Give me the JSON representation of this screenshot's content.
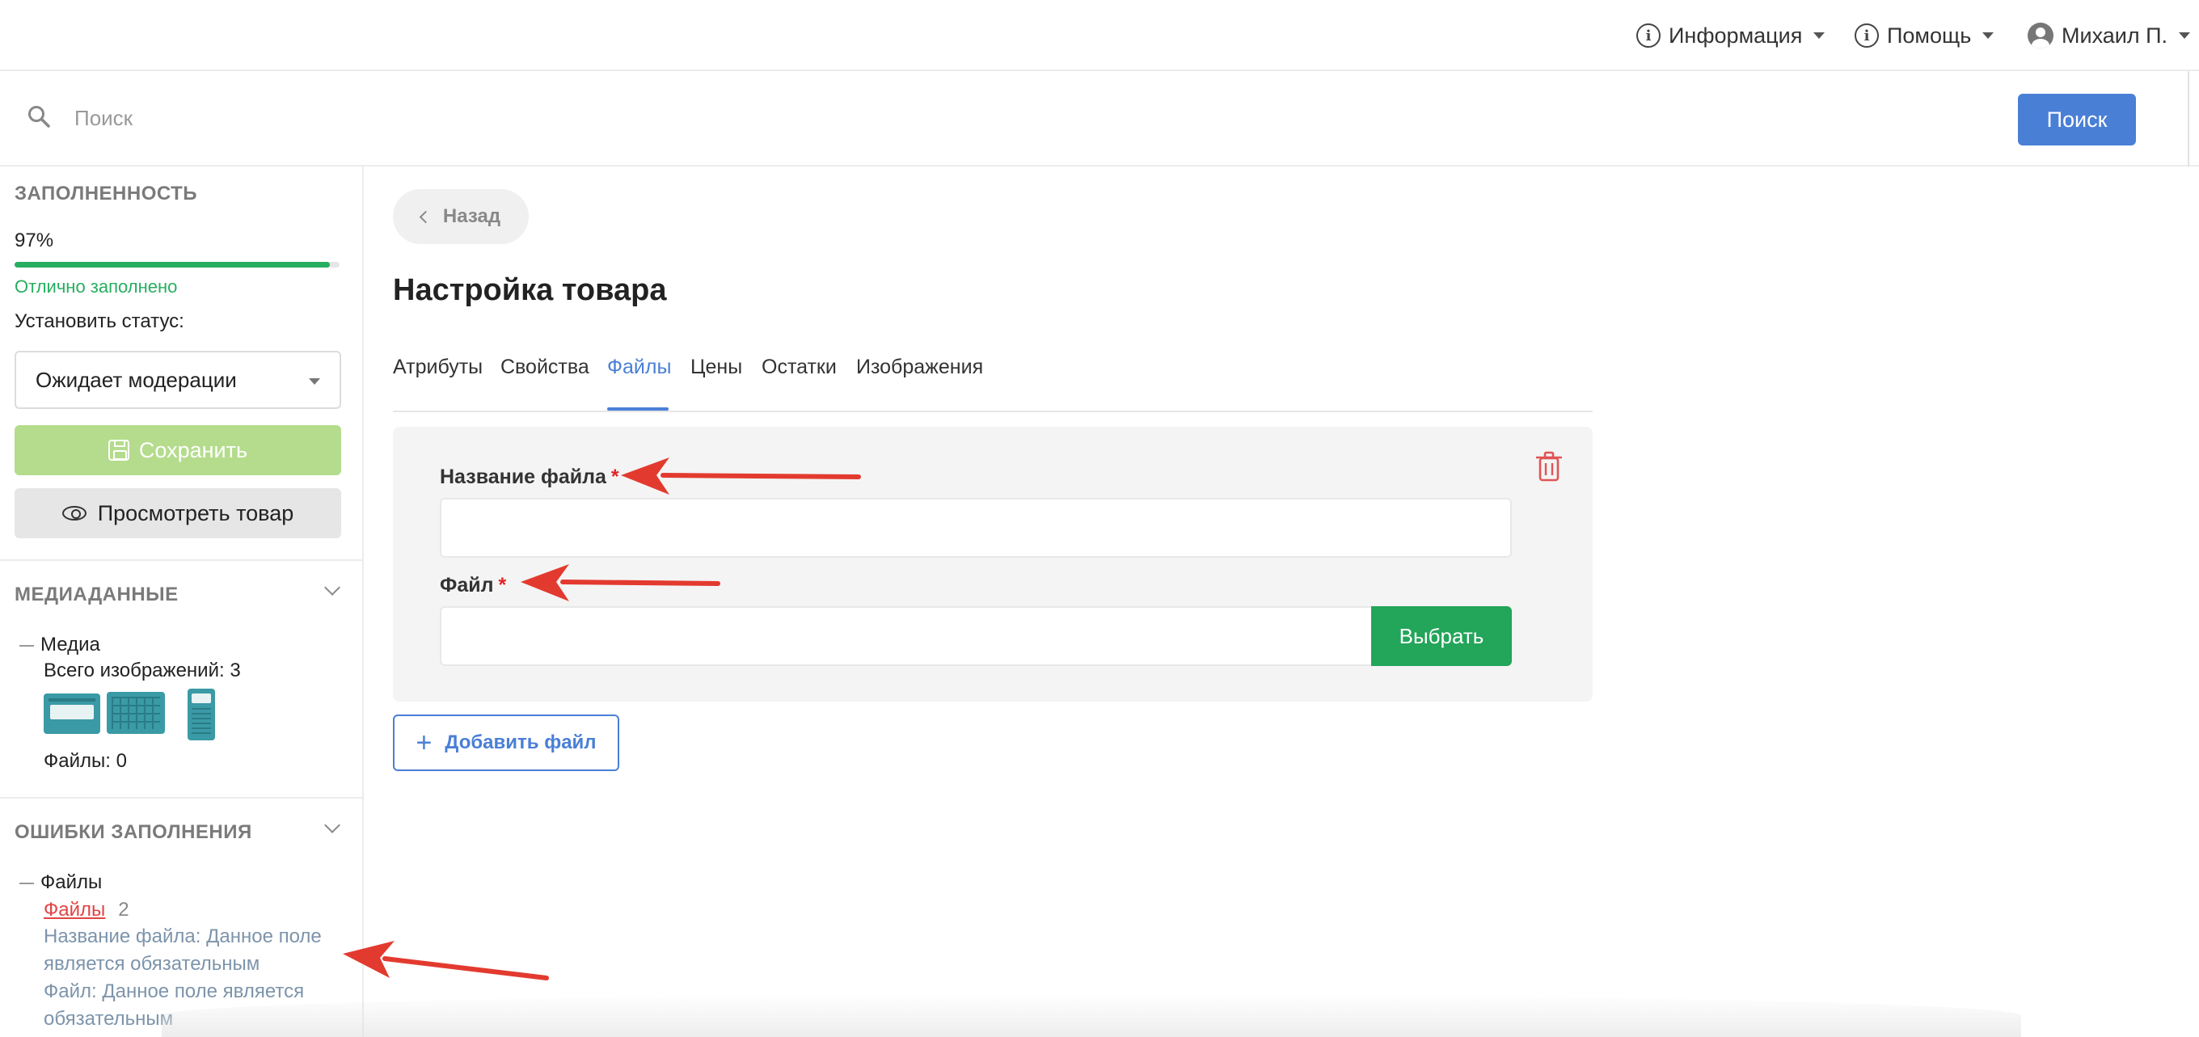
{
  "topnav": {
    "info": "Информация",
    "help": "Помощь",
    "user": "Михаил П."
  },
  "search": {
    "placeholder": "Поиск",
    "button": "Поиск"
  },
  "sidebar": {
    "completeness": {
      "heading": "ЗАПОЛНЕННОСТЬ",
      "percent_text": "97%",
      "percent": 97,
      "status": "Отлично заполнено",
      "set_status_label": "Установить статус:",
      "status_value": "Ожидает модерации",
      "save_label": "Сохранить",
      "view_label": "Просмотреть товар"
    },
    "media": {
      "heading": "МЕДИАДАННЫЕ",
      "group": "Медиа",
      "images_total": "Всего изображений: 3",
      "files_count": "Файлы: 0"
    },
    "errors": {
      "heading": "ОШИБКИ ЗАПОЛНЕНИЯ",
      "group": "Файлы",
      "link": "Файлы",
      "count": "2",
      "messages": [
        "Название файла: Данное поле является обязательным",
        "Файл: Данное поле является обязательным"
      ]
    }
  },
  "main": {
    "back": "Назад",
    "title": "Настройка товара",
    "tabs": [
      "Атрибуты",
      "Свойства",
      "Файлы",
      "Цены",
      "Остатки",
      "Изображения"
    ],
    "active_tab": "Файлы",
    "file_form": {
      "name_label": "Название файла",
      "file_label": "Файл",
      "required_mark": "*",
      "pick_button": "Выбрать"
    },
    "add_file": "Добавить файл"
  },
  "colors": {
    "accent": "#4a7fd6",
    "success": "#23a55a",
    "danger": "#e02424",
    "save_disabled": "#b4dc8c"
  }
}
